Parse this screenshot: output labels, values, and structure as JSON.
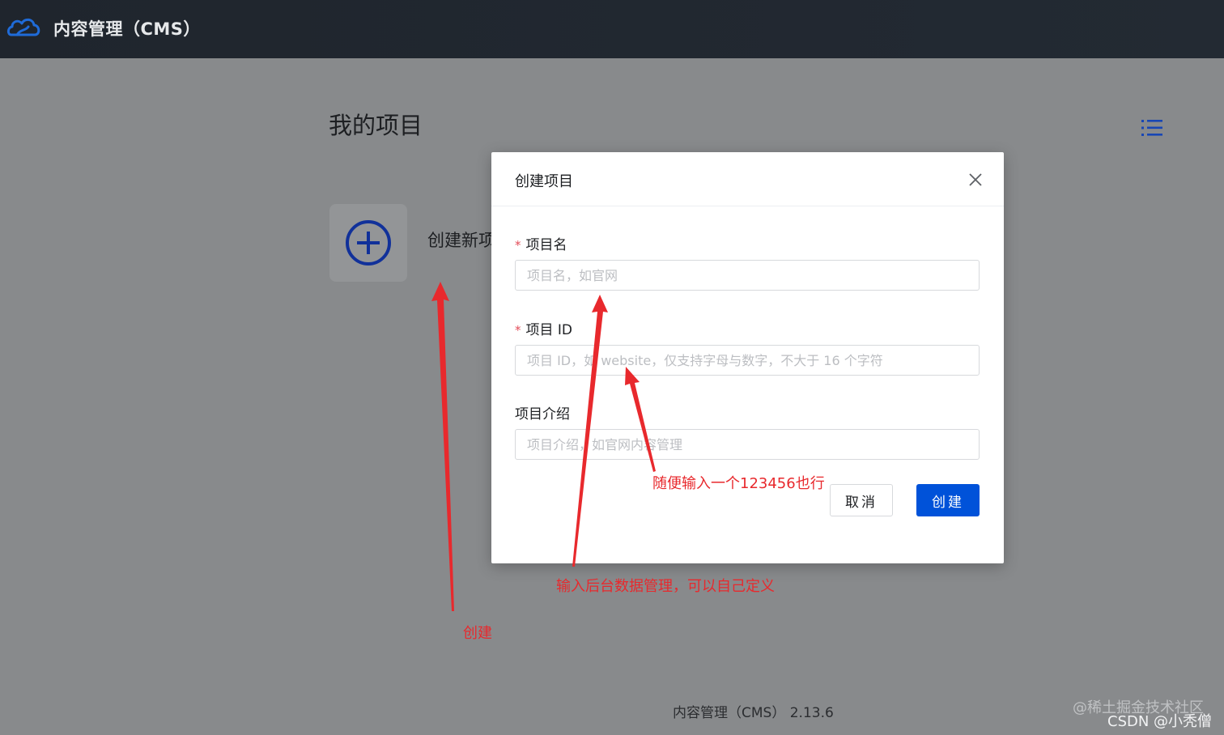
{
  "header": {
    "app_title": "内容管理（CMS）",
    "logo_icon": "cloud-icon"
  },
  "main": {
    "page_title": "我的项目",
    "list_icon": "list-icon",
    "create_card_label": "创建新项",
    "create_icon": "plus-circle-icon"
  },
  "modal": {
    "title": "创建项目",
    "close_icon": "close-icon",
    "required_mark": "*",
    "fields": [
      {
        "label": "项目名",
        "required": true,
        "placeholder": "项目名，如官网",
        "value": ""
      },
      {
        "label": "项目 ID",
        "required": true,
        "placeholder": "项目 ID，如 website，仅支持字母与数字，不大于 16 个字符",
        "value": ""
      },
      {
        "label": "项目介绍",
        "required": false,
        "placeholder": "项目介绍，如官网内容管理",
        "value": ""
      }
    ],
    "cancel_label": "取消",
    "create_label": "创建"
  },
  "footer": {
    "version_text": "内容管理（CMS） 2.13.6"
  },
  "annotations": {
    "id_hint": "随便输入一个123456也行",
    "name_hint": "输入后台数据管理，可以自己定义",
    "create_hint": "创建"
  },
  "watermark": {
    "line1": "@稀土掘金技术社区",
    "line2": "CSDN @小秃僧"
  },
  "colors": {
    "primary": "#0052d9",
    "annotation": "#e8292d",
    "overlay": "#888a8c",
    "header_bg": "#1f252d"
  }
}
